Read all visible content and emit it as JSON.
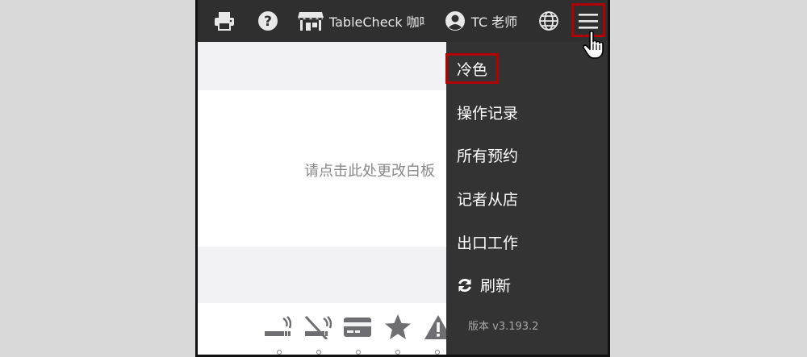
{
  "topbar": {
    "restaurant_name": "TableCheck 咖啡",
    "user_name": "TC 老师"
  },
  "board": {
    "placeholder_text": "请点击此处更改白板"
  },
  "menu": {
    "items": [
      {
        "label": "冷色"
      },
      {
        "label": "操作记录"
      },
      {
        "label": "所有预约"
      },
      {
        "label": "记者从店"
      },
      {
        "label": "出口工作"
      },
      {
        "label": "刷新"
      }
    ],
    "version": "版本 v3.193.2"
  },
  "icons": {
    "topbar": [
      "printer-icon",
      "help-icon",
      "store-icon",
      "user-circle-icon",
      "globe-icon",
      "hamburger-icon",
      "hand-cursor-icon"
    ],
    "footer": [
      "smoking-icon",
      "no-smoking-icon",
      "credit-card-icon",
      "star-icon",
      "warning-icon"
    ]
  },
  "colors": {
    "topbar_bg": "#2f2f2f",
    "menu_bg": "#333333",
    "highlight": "#b00000"
  }
}
